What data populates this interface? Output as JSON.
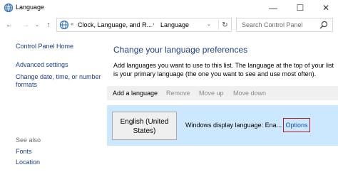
{
  "window": {
    "title": "Language",
    "minimize_glyph": "—",
    "maximize_glyph": "☐",
    "close_glyph": "✕"
  },
  "nav": {
    "back_glyph": "←",
    "forward_glyph": "→",
    "history_glyph": "⌄",
    "up_glyph": "↑",
    "address": {
      "separator1": "«",
      "crumb1": "Clock, Language, and R...",
      "separator2": "›",
      "crumb2": "Language",
      "dropdown_glyph": "⌄",
      "refresh_glyph": "↻"
    },
    "search": {
      "placeholder": "Search Control Panel"
    }
  },
  "sidebar": {
    "home": "Control Panel Home",
    "advanced": "Advanced settings",
    "date_formats": "Change date, time, or number formats",
    "see_also": "See also",
    "fonts": "Fonts",
    "location": "Location"
  },
  "main": {
    "title": "Change your language preferences",
    "description": "Add languages you want to use to this list. The language at the top of your list is your primary language (the one you want to see and use most often).",
    "toolbar": {
      "add": "Add a language",
      "remove": "Remove",
      "move_up": "Move up",
      "move_down": "Move down"
    },
    "languages": [
      {
        "name": "English (United States)",
        "display_text": "Windows display language: Ena...",
        "options_label": "Options"
      }
    ]
  },
  "colors": {
    "link": "#1a3f8e",
    "title": "#1e3f8a",
    "selected_row": "#cce8ff",
    "toolbar_bg": "#f0f0f0",
    "options_outline": "#b11a1a"
  },
  "icons": {
    "app": "language-globe-icon",
    "search": "search-icon"
  }
}
